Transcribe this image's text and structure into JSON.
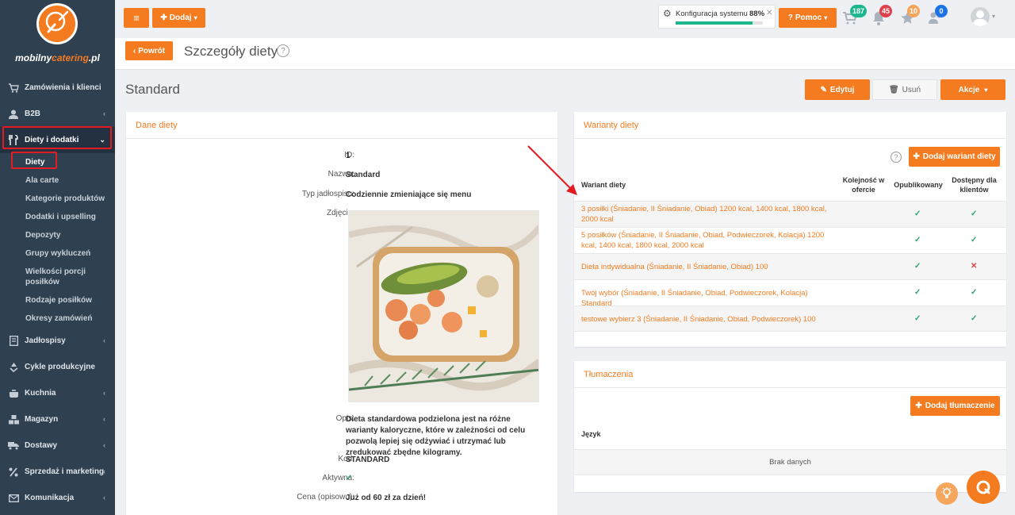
{
  "brand": {
    "logo_main": "mobilny",
    "logo_accent": "catering",
    "logo_suffix": ".pl"
  },
  "sidebar": {
    "items": [
      {
        "label": "Zamówienia i klienci",
        "icon": "cart-icon"
      },
      {
        "label": "B2B",
        "icon": "user-icon"
      },
      {
        "label": "Diety i dodatki",
        "icon": "cutlery-icon"
      }
    ],
    "sub_items": [
      "Diety",
      "Ala carte",
      "Kategorie produktów",
      "Dodatki i upselling",
      "Depozyty",
      "Grupy wykluczeń",
      "Wielkości porcji posiłków",
      "Rodzaje posiłków",
      "Okresy zamówień"
    ],
    "items_after": [
      {
        "label": "Jadłospisy",
        "icon": "book-icon"
      },
      {
        "label": "Cykle produkcyjne",
        "icon": "recycle-icon"
      },
      {
        "label": "Kuchnia",
        "icon": "pot-icon"
      },
      {
        "label": "Magazyn",
        "icon": "boxes-icon"
      },
      {
        "label": "Dostawy",
        "icon": "truck-icon"
      },
      {
        "label": "Sprzedaż i marketing",
        "icon": "percent-icon"
      },
      {
        "label": "Komunikacja",
        "icon": "envelope-icon"
      }
    ]
  },
  "topbar": {
    "menu_icon": "hamburger-icon",
    "add_label": "Dodaj",
    "config_label": "Konfiguracja systemu",
    "config_percent": "88%",
    "config_progress": 0.88,
    "help_label": "Pomoc",
    "badges": {
      "cart": "187",
      "bell": "45",
      "star": "10",
      "users": "0"
    }
  },
  "titlebar": {
    "back_label": "Powrót",
    "title": "Szczegóły diety"
  },
  "page": {
    "heading": "Standard",
    "edit_label": "Edytuj",
    "delete_label": "Usuń",
    "actions_label": "Akcje"
  },
  "details": {
    "title": "Dane diety",
    "id_label": "ID:",
    "id": "1",
    "name_label": "Nazwa:",
    "name": "Standard",
    "menu_type_label": "Typ jadłospisu:",
    "menu_type": "Codziennie zmieniające się menu",
    "photo_label": "Zdjęcie:",
    "desc_label": "Opis:",
    "desc": "Dieta standardowa podzielona jest na różne warianty kaloryczne, które w zależności od celu pozwolą lepiej się odżywiać i utrzymać lub zredukować zbędne kilogramy.",
    "code_label": "Kod:",
    "code": "STANDARD",
    "active_label": "Aktywna:",
    "price_label": "Cena (opisowo):",
    "price": "Już od 60 zł za dzień!"
  },
  "variants": {
    "title": "Warianty diety",
    "add_label": "Dodaj wariant diety",
    "col_name": "Wariant diety",
    "col_order": "Kolejność w ofercie",
    "col_published": "Opublikowany",
    "col_available": "Dostępny dla klientów",
    "rows": [
      {
        "name": "3 posiłki (Śniadanie, II Śniadanie, Obiad) 1200 kcal, 1400 kcal, 1800 kcal, 2000 kcal",
        "published": true,
        "available": true
      },
      {
        "name": "5 posiłków (Śniadanie, II Śniadanie, Obiad, Podwieczorek, Kolacja) 1200 kcal, 1400 kcal, 1800 kcal, 2000 kcal",
        "published": true,
        "available": true
      },
      {
        "name": "Dieta indywidualna (Śniadanie, II Śniadanie, Obiad) 100",
        "published": true,
        "available": false
      },
      {
        "name": "Twój wybór (Śniadanie, II Śniadanie, Obiad, Podwieczorek, Kolacja) Standard",
        "published": true,
        "available": true
      },
      {
        "name": "testowe wybierz 3 (Śniadanie, II Śniadanie, Obiad, Podwieczorek) 100",
        "published": true,
        "available": true
      }
    ]
  },
  "translations": {
    "title": "Tłumaczenia",
    "add_label": "Dodaj tłumaczenie",
    "col_lang": "Język",
    "empty": "Brak danych"
  },
  "colors": {
    "accent": "#f47b20",
    "sidebar": "#2f4050",
    "success": "#2aa36b",
    "danger": "#e0404a",
    "highlight": "#e31b23"
  }
}
